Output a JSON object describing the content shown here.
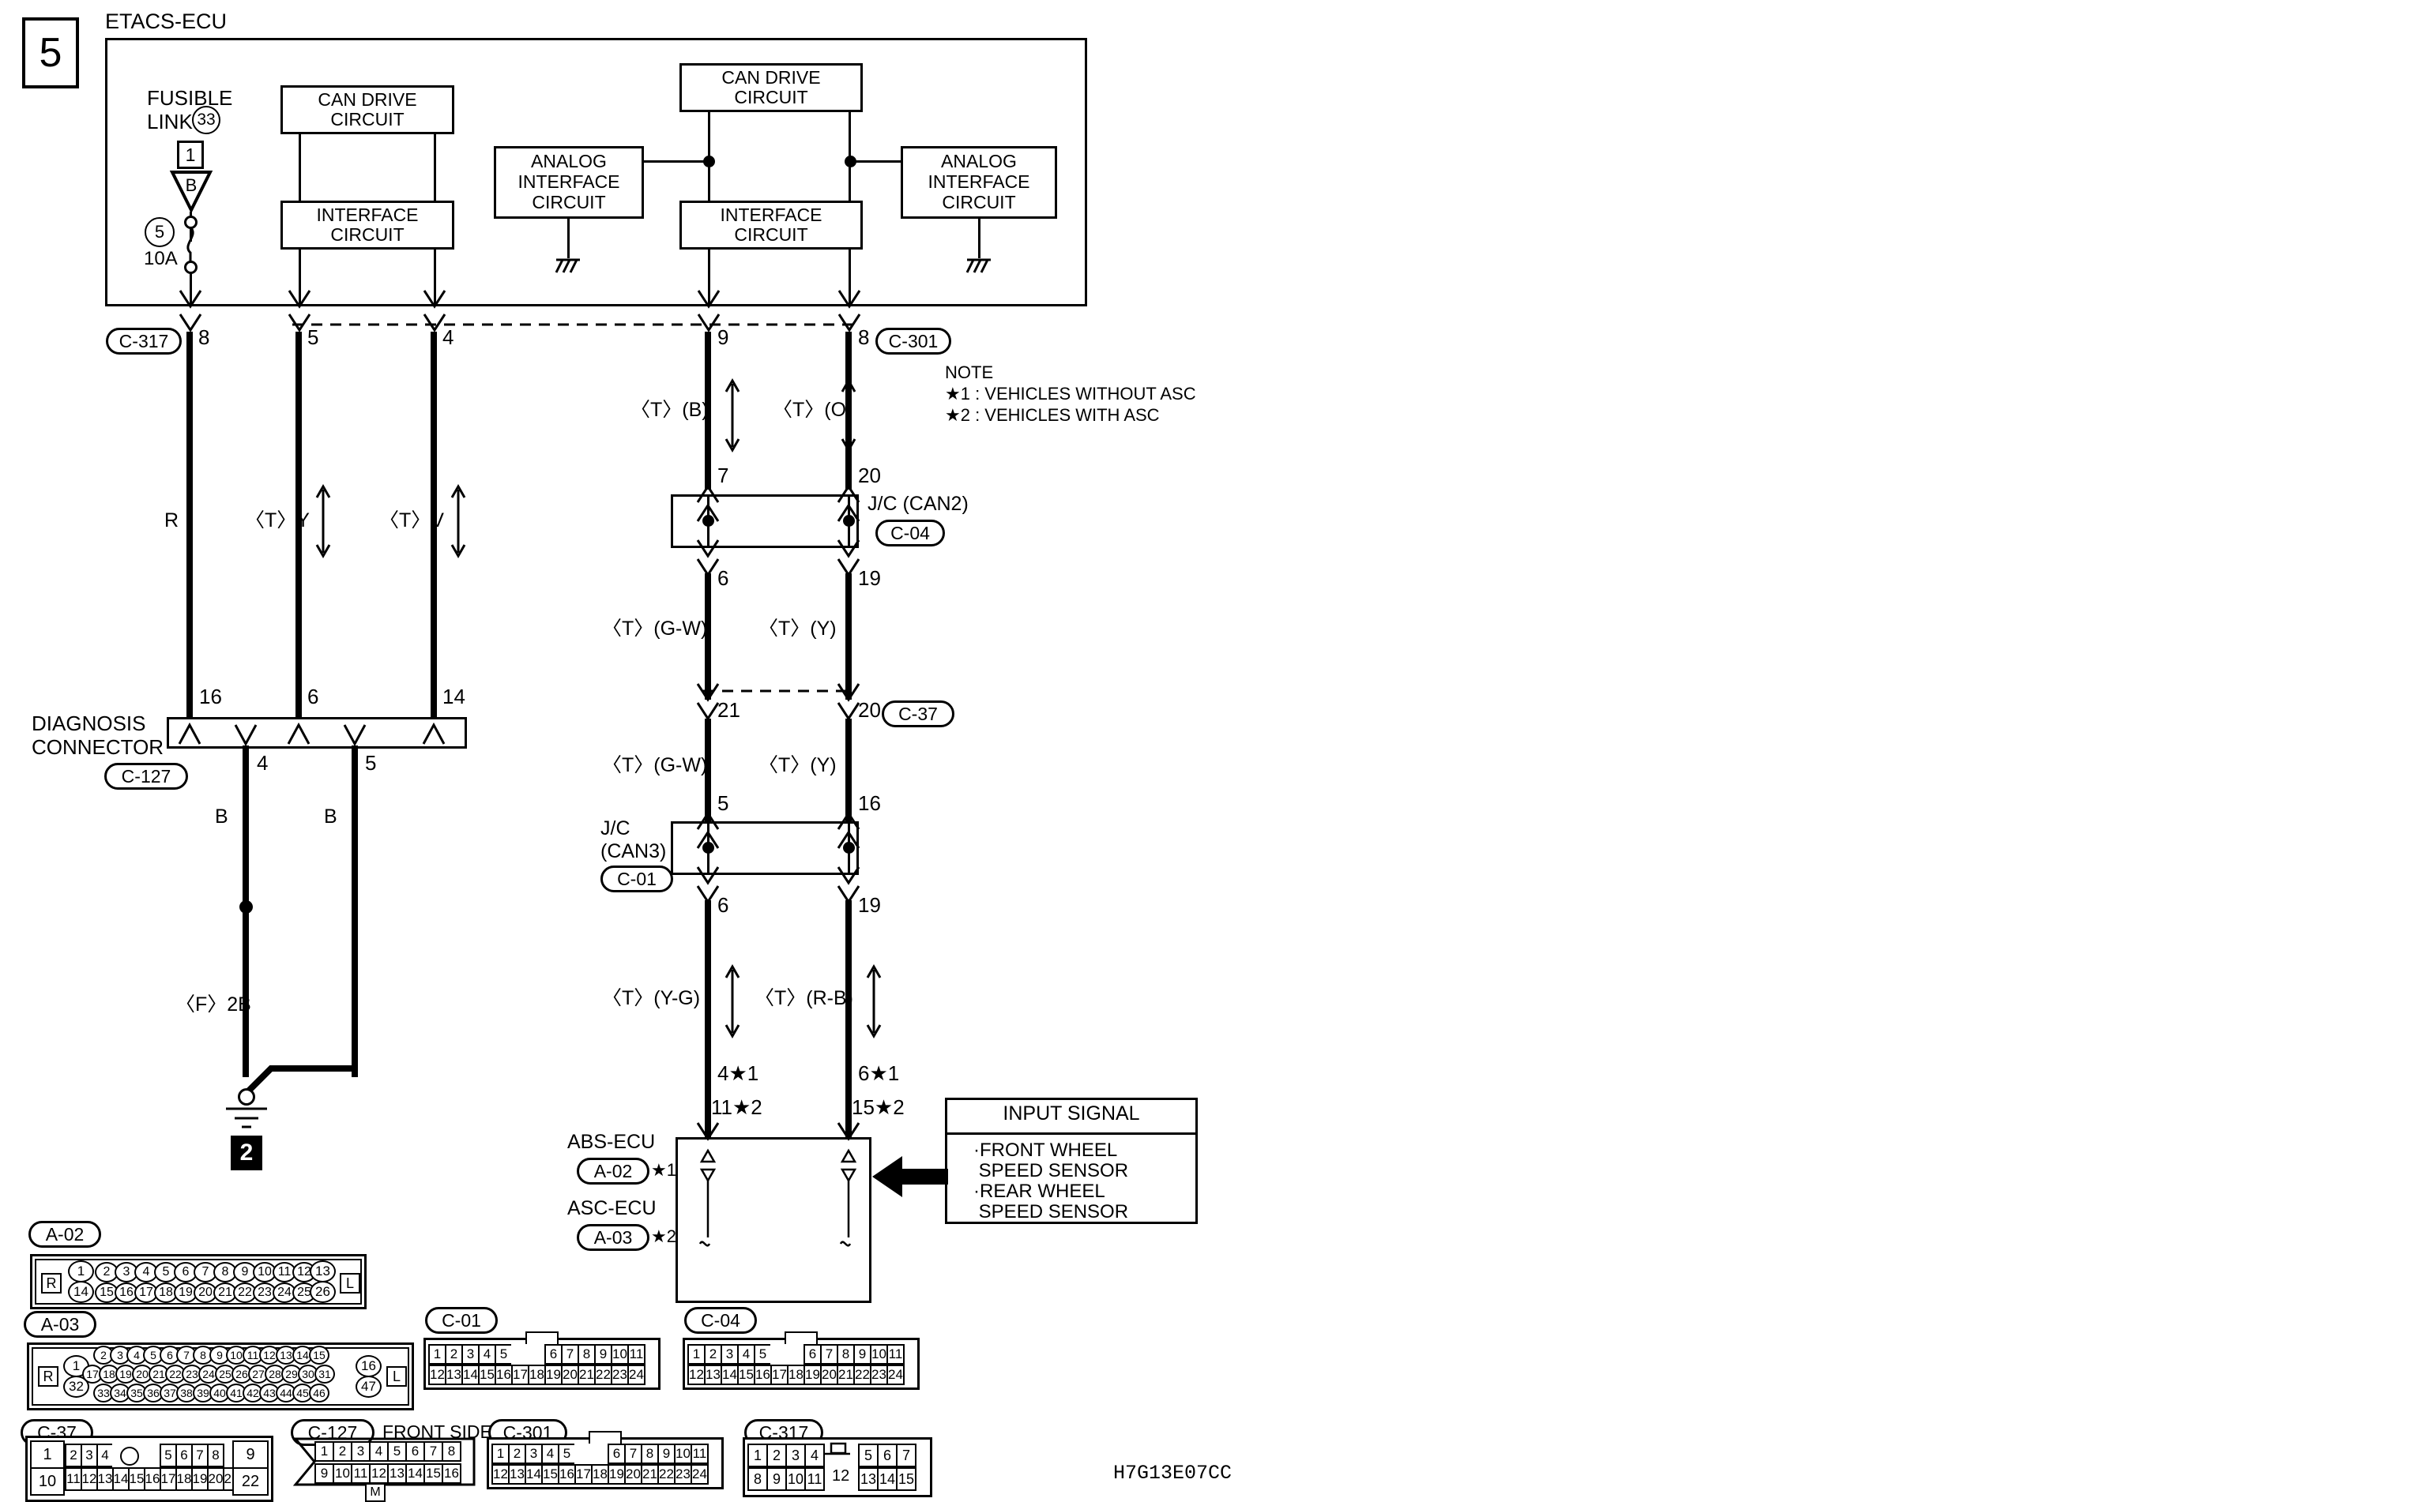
{
  "diagram": {
    "id_code": "H7G13E07CC",
    "page_marker": "5",
    "ground_marker": "2",
    "title": "ETACS-ECU"
  },
  "ecu": {
    "label": "ETACS-ECU",
    "fusible_link": {
      "line1": "FUSIBLE",
      "line2": "LINK",
      "badge": "33",
      "box_num": "1",
      "tri_letter": "B"
    },
    "fuse": {
      "circle": "5",
      "rating": "10A"
    },
    "blocks": [
      {
        "name": "can-drive-left",
        "line1": "CAN DRIVE",
        "line2": "CIRCUIT"
      },
      {
        "name": "interface-left",
        "line1": "INTERFACE",
        "line2": "CIRCUIT"
      },
      {
        "name": "analog-left",
        "line1": "ANALOG",
        "line2": "INTERFACE",
        "line3": "CIRCUIT"
      },
      {
        "name": "can-drive-right",
        "line1": "CAN DRIVE",
        "line2": "CIRCUIT"
      },
      {
        "name": "interface-right",
        "line1": "INTERFACE",
        "line2": "CIRCUIT"
      },
      {
        "name": "analog-right",
        "line1": "ANALOG",
        "line2": "INTERFACE",
        "line3": "CIRCUIT"
      }
    ]
  },
  "note": {
    "heading": "NOTE",
    "lines": [
      "★1 : VEHICLES WITHOUT ASC",
      "★2 : VEHICLES WITH ASC"
    ]
  },
  "connector_tags": {
    "c317": "C-317",
    "c301": "C-301",
    "c04": "C-04",
    "c37": "C-37",
    "c01": "C-01",
    "c127": "C-127",
    "a02": "A-02",
    "a03": "A-03"
  },
  "pins": {
    "etacs_top": [
      "8",
      "5",
      "4",
      "9",
      "8"
    ],
    "jc_can2_top": [
      "7",
      "20"
    ],
    "jc_can2_bottom": [
      "6",
      "19"
    ],
    "diag_top": [
      "16",
      "6",
      "14"
    ],
    "diag_bottom": [
      "4",
      "5"
    ],
    "c37_row": [
      "21",
      "20"
    ],
    "jc_can3_top": [
      "5",
      "16"
    ],
    "jc_can3_bottom": [
      "6",
      "19"
    ],
    "abs_top_left": [
      "4★1",
      "11★2"
    ],
    "abs_top_right": [
      "6★1",
      "15★2"
    ]
  },
  "wire_labels": {
    "r": "R",
    "ty": "〈T〉Y",
    "tv": "〈T〉V",
    "tb": "〈T〉(B)",
    "to": "〈T〉(O)",
    "tgw_upper": "〈T〉(G-W)",
    "ty_paren_upper": "〈T〉(Y)",
    "tgw_lower": "〈T〉(G-W)",
    "ty_paren_lower": "〈T〉(Y)",
    "tyg": "〈T〉(Y-G)",
    "trb": "〈T〉(R-B)",
    "b_left": "B",
    "b_right": "B",
    "f2b": "〈F〉2B"
  },
  "junctions": {
    "can2": {
      "line1": "J/C (CAN2)",
      "tag": "C-04"
    },
    "can3": {
      "line1": "J/C",
      "line2": "(CAN3)",
      "tag": "C-01"
    }
  },
  "diagnosis_connector": {
    "line1": "DIAGNOSIS",
    "line2": "CONNECTOR",
    "tag": "C-127"
  },
  "ecu_bottom": {
    "abs_label": "ABS-ECU",
    "abs_tag": "A-02",
    "abs_star": "★1",
    "asc_label": "ASC-ECU",
    "asc_tag": "A-03",
    "asc_star": "★2"
  },
  "input_signal": {
    "title": "INPUT SIGNAL",
    "items": [
      "·FRONT WHEEL",
      " SPEED SENSOR",
      "·REAR WHEEL",
      " SPEED SENSOR"
    ]
  },
  "connector_views": {
    "a02": {
      "tag": "A-02",
      "left_mark": "R",
      "right_mark": "L",
      "lead_top": "1",
      "lead_bottom": "14",
      "tail_top": "13",
      "tail_bottom": "26",
      "row_top": [
        "2",
        "3",
        "4",
        "5",
        "6",
        "7",
        "8",
        "9",
        "10",
        "11",
        "12"
      ],
      "row_bottom": [
        "15",
        "16",
        "17",
        "18",
        "19",
        "20",
        "21",
        "22",
        "23",
        "24",
        "25"
      ]
    },
    "a03": {
      "tag": "A-03",
      "left_mark": "R",
      "right_mark": "L",
      "lead_top": "1",
      "lead_bottom": "32",
      "tail_top": "16",
      "tail_bottom": "47",
      "row_top": [
        "2",
        "3",
        "4",
        "5",
        "6",
        "7",
        "8",
        "9",
        "10",
        "11",
        "12",
        "13",
        "14",
        "15"
      ],
      "row_mid": [
        "17",
        "18",
        "19",
        "20",
        "21",
        "22",
        "23",
        "24",
        "25",
        "26",
        "27",
        "28",
        "29",
        "30",
        "31"
      ],
      "row_bottom": [
        "33",
        "34",
        "35",
        "36",
        "37",
        "38",
        "39",
        "40",
        "41",
        "42",
        "43",
        "44",
        "45",
        "46"
      ]
    },
    "c01": {
      "tag": "C-01",
      "row_top": [
        "1",
        "2",
        "3",
        "4",
        "5",
        "",
        "",
        "6",
        "7",
        "8",
        "9",
        "10",
        "11"
      ],
      "row_bottom": [
        "12",
        "13",
        "14",
        "15",
        "16",
        "17",
        "18",
        "19",
        "20",
        "21",
        "22",
        "23",
        "24"
      ]
    },
    "c04": {
      "tag": "C-04",
      "row_top": [
        "1",
        "2",
        "3",
        "4",
        "5",
        "",
        "",
        "6",
        "7",
        "8",
        "9",
        "10",
        "11"
      ],
      "row_bottom": [
        "12",
        "13",
        "14",
        "15",
        "16",
        "17",
        "18",
        "19",
        "20",
        "21",
        "22",
        "23",
        "24"
      ]
    },
    "c37": {
      "tag": "C-37",
      "lead_top": "1",
      "lead_bottom": "10",
      "tail_top": "9",
      "tail_bottom": "22",
      "row_top": [
        "2",
        "3",
        "4",
        "",
        "",
        "",
        "5",
        "6",
        "7",
        "8"
      ],
      "row_bottom": [
        "11",
        "12",
        "13",
        "14",
        "15",
        "16",
        "17",
        "18",
        "19",
        "20",
        "21"
      ]
    },
    "c127": {
      "tag": "C-127",
      "side_label": "FRONT SIDE",
      "bottom_mark": "M",
      "row_top": [
        "1",
        "2",
        "3",
        "4",
        "5",
        "6",
        "7",
        "8"
      ],
      "row_bottom": [
        "9",
        "10",
        "11",
        "12",
        "13",
        "14",
        "15",
        "16"
      ]
    },
    "c301": {
      "tag": "C-301",
      "row_top": [
        "1",
        "2",
        "3",
        "4",
        "5",
        "",
        "",
        "6",
        "7",
        "8",
        "9",
        "10",
        "11"
      ],
      "row_bottom": [
        "12",
        "13",
        "14",
        "15",
        "16",
        "17",
        "18",
        "19",
        "20",
        "21",
        "22",
        "23",
        "24"
      ]
    },
    "c317": {
      "tag": "C-317",
      "row_top": [
        "1",
        "2",
        "3",
        "4"
      ],
      "row_top2": [
        "5",
        "6",
        "7"
      ],
      "row_bottom": [
        "8",
        "9",
        "10",
        "11"
      ],
      "row_bottom2": [
        "13",
        "14",
        "15"
      ],
      "center": "12"
    }
  }
}
